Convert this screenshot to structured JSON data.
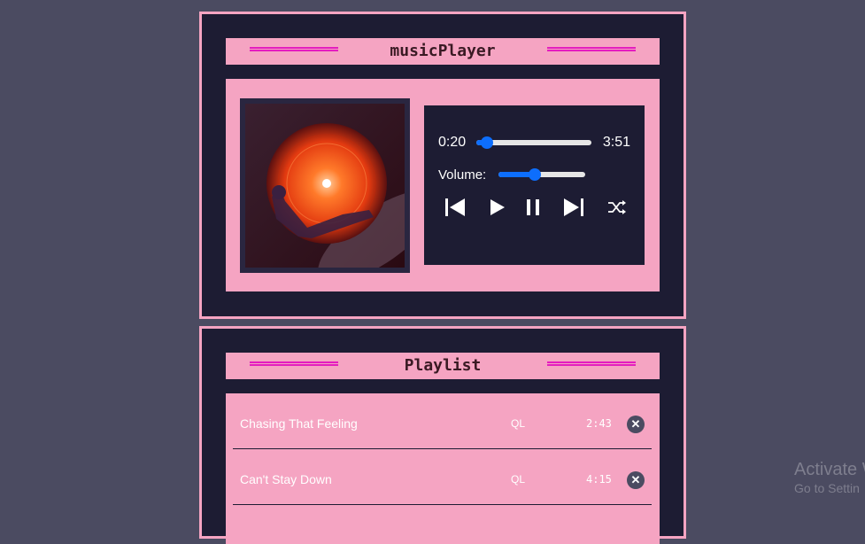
{
  "player": {
    "title": "musicPlayer",
    "current_time": "0:20",
    "total_time": "3:51",
    "progress_fraction": 0.09,
    "volume_label": "Volume:",
    "volume_fraction": 0.42,
    "icons": {
      "prev": "skip-previous-icon",
      "play": "play-icon",
      "pause": "pause-icon",
      "next": "skip-next-icon",
      "shuffle": "shuffle-icon"
    }
  },
  "playlist": {
    "title": "Playlist",
    "tracks": [
      {
        "title": "Chasing That Feeling",
        "artist": "QL",
        "duration": "2:43"
      },
      {
        "title": "Can't Stay Down",
        "artist": "QL",
        "duration": "4:15"
      }
    ]
  },
  "watermark": {
    "title": "Activate W",
    "subtitle": "Go to Settin"
  },
  "colors": {
    "page_bg": "#4b4b61",
    "panel_bg": "#1d1c33",
    "pink": "#f5a4c2",
    "magenta_line": "#e41dbf",
    "slider_blue": "#0d6efd"
  }
}
